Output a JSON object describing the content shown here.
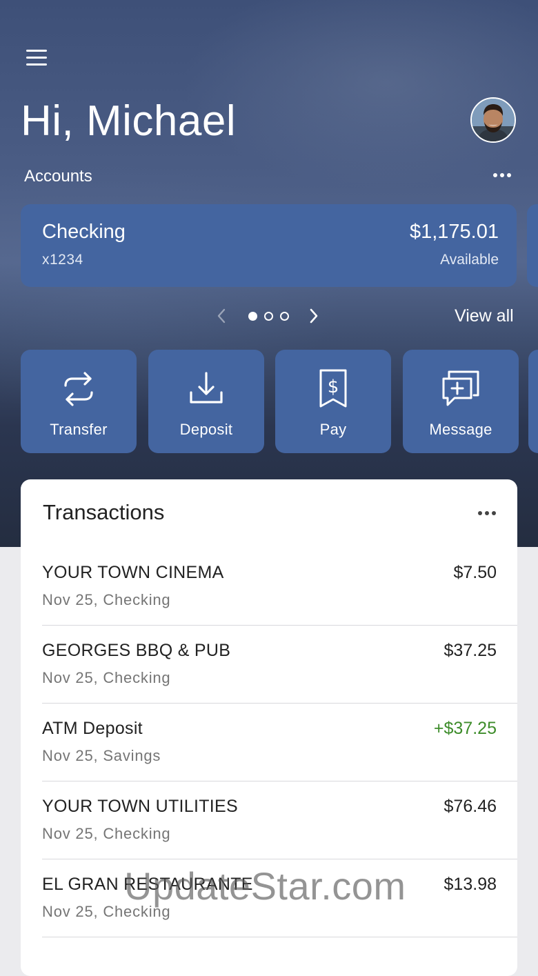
{
  "header": {
    "greeting": "Hi, Michael",
    "accounts_label": "Accounts"
  },
  "account": {
    "name": "Checking",
    "number": "x1234",
    "balance": "$1,175.01",
    "balance_label": "Available"
  },
  "pager": {
    "pages": 3,
    "current": 1
  },
  "view_all": "View all",
  "actions": [
    {
      "label": "Transfer",
      "icon": "transfer-icon"
    },
    {
      "label": "Deposit",
      "icon": "deposit-icon"
    },
    {
      "label": "Pay",
      "icon": "bill-pay-icon"
    },
    {
      "label": "Message",
      "icon": "message-icon"
    }
  ],
  "transactions": {
    "title": "Transactions",
    "rows": [
      {
        "name": "YOUR TOWN CINEMA",
        "sub": "Nov 25, Checking",
        "amount": "$7.50",
        "credit": false
      },
      {
        "name": "GEORGES BBQ & PUB",
        "sub": "Nov 25, Checking",
        "amount": "$37.25",
        "credit": false
      },
      {
        "name": "ATM Deposit",
        "sub": "Nov 25, Savings",
        "amount": "+$37.25",
        "credit": true
      },
      {
        "name": "YOUR TOWN UTILITIES",
        "sub": "Nov 25, Checking",
        "amount": "$76.46",
        "credit": false
      },
      {
        "name": "EL GRAN RESTAURANTE",
        "sub": "Nov 25, Checking",
        "amount": "$13.98",
        "credit": false
      }
    ]
  },
  "colors": {
    "card_blue": "#4465a0",
    "credit_green": "#3d8c2a"
  },
  "watermark": "UpdateStar.com"
}
